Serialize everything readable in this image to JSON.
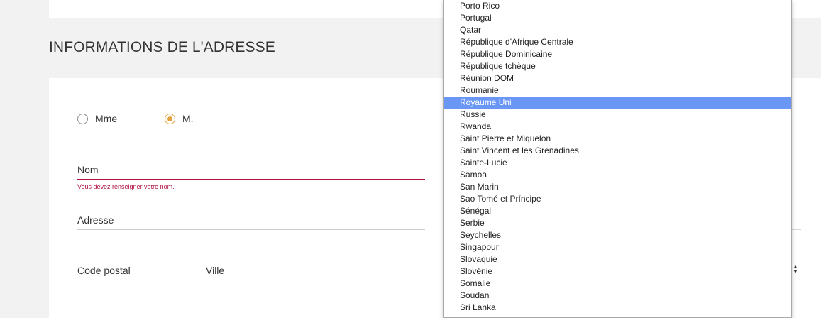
{
  "section": {
    "title": "INFORMATIONS DE L'ADRESSE"
  },
  "civility": {
    "options": [
      {
        "label": "Mme",
        "checked": false
      },
      {
        "label": "M.",
        "checked": true
      }
    ]
  },
  "form": {
    "nom_label": "Nom",
    "nom_error": "Vous devez renseigner votre nom.",
    "adresse_label": "Adresse",
    "code_postal_label": "Code postal",
    "ville_label": "Ville"
  },
  "country_dropdown": {
    "selected": "Royaume Uni",
    "items": [
      "Porto Rico",
      "Portugal",
      "Qatar",
      "République d'Afrique Centrale",
      "République Dominicaine",
      "République tchèque",
      "Réunion DOM",
      "Roumanie",
      "Royaume Uni",
      "Russie",
      "Rwanda",
      "Saint Pierre et Miquelon",
      "Saint Vincent et les Grenadines",
      "Sainte-Lucie",
      "Samoa",
      "San Marin",
      "Sao Tomé et Príncipe",
      "Sénégal",
      "Serbie",
      "Seychelles",
      "Singapour",
      "Slovaquie",
      "Slovénie",
      "Somalie",
      "Soudan",
      "Sri Lanka"
    ]
  },
  "colors": {
    "accent": "#e6a23c",
    "error": "#b0123f",
    "selection": "#6a97f5",
    "valid": "#3aa54a"
  }
}
